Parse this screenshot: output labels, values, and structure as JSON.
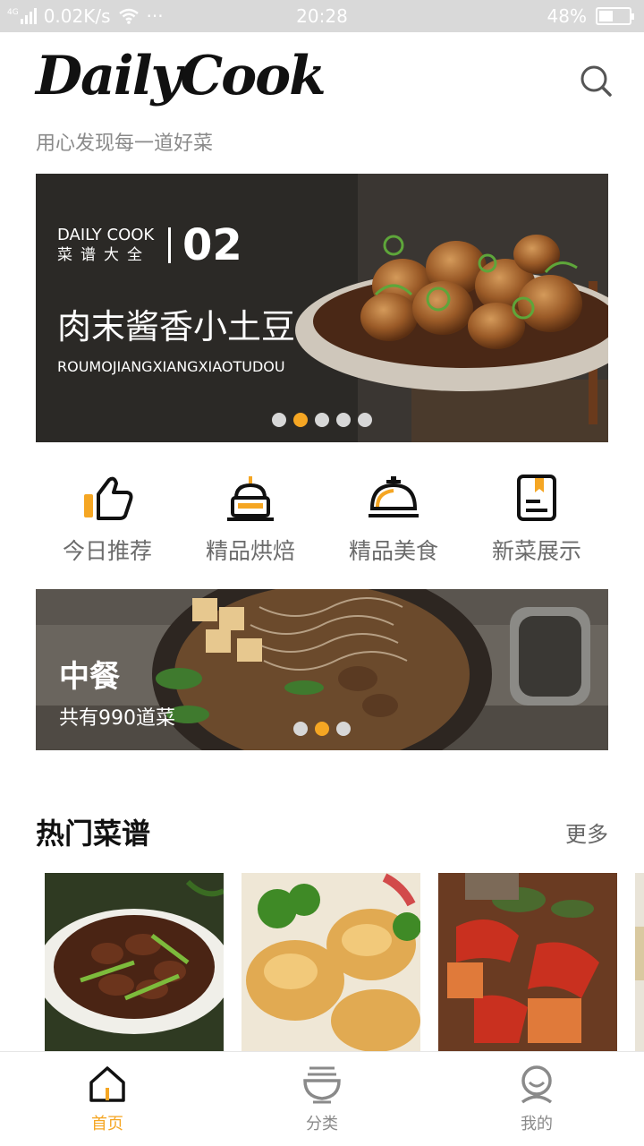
{
  "status_bar": {
    "network": "0.02K/s",
    "signal": "4G",
    "more": "···",
    "time": "20:28",
    "battery_percent": "48%",
    "battery_level": 0.48
  },
  "header": {
    "logo": "DailyCook",
    "slogan": "用心发现每一道好菜",
    "search_icon": "search-icon"
  },
  "banner": {
    "brand": "DAILY COOK",
    "brand_sub": "菜谱大全",
    "number": "02",
    "title": "肉末酱香小土豆",
    "pinyin": "ROUMOJIANGXIANGXIAOTUDOU",
    "dot_count": 5,
    "active_dot": 1
  },
  "categories": [
    {
      "label": "今日推荐",
      "icon": "thumbs-up-icon"
    },
    {
      "label": "精品烘焙",
      "icon": "cake-icon"
    },
    {
      "label": "精品美食",
      "icon": "food-cloche-icon"
    },
    {
      "label": "新菜展示",
      "icon": "recipe-book-icon"
    }
  ],
  "category_banner": {
    "title": "中餐",
    "count": "共有990道菜",
    "dot_count": 3,
    "active_dot": 1
  },
  "popular": {
    "title": "热门菜谱",
    "more": "更多"
  },
  "tabbar": [
    {
      "label": "首页",
      "icon": "home-icon",
      "active": true
    },
    {
      "label": "分类",
      "icon": "category-bowl-icon",
      "active": false
    },
    {
      "label": "我的",
      "icon": "profile-icon",
      "active": false
    }
  ],
  "colors": {
    "accent": "#f5a623",
    "text_muted": "#8a8a8a",
    "status_bar_bg": "#d9d9d9"
  }
}
